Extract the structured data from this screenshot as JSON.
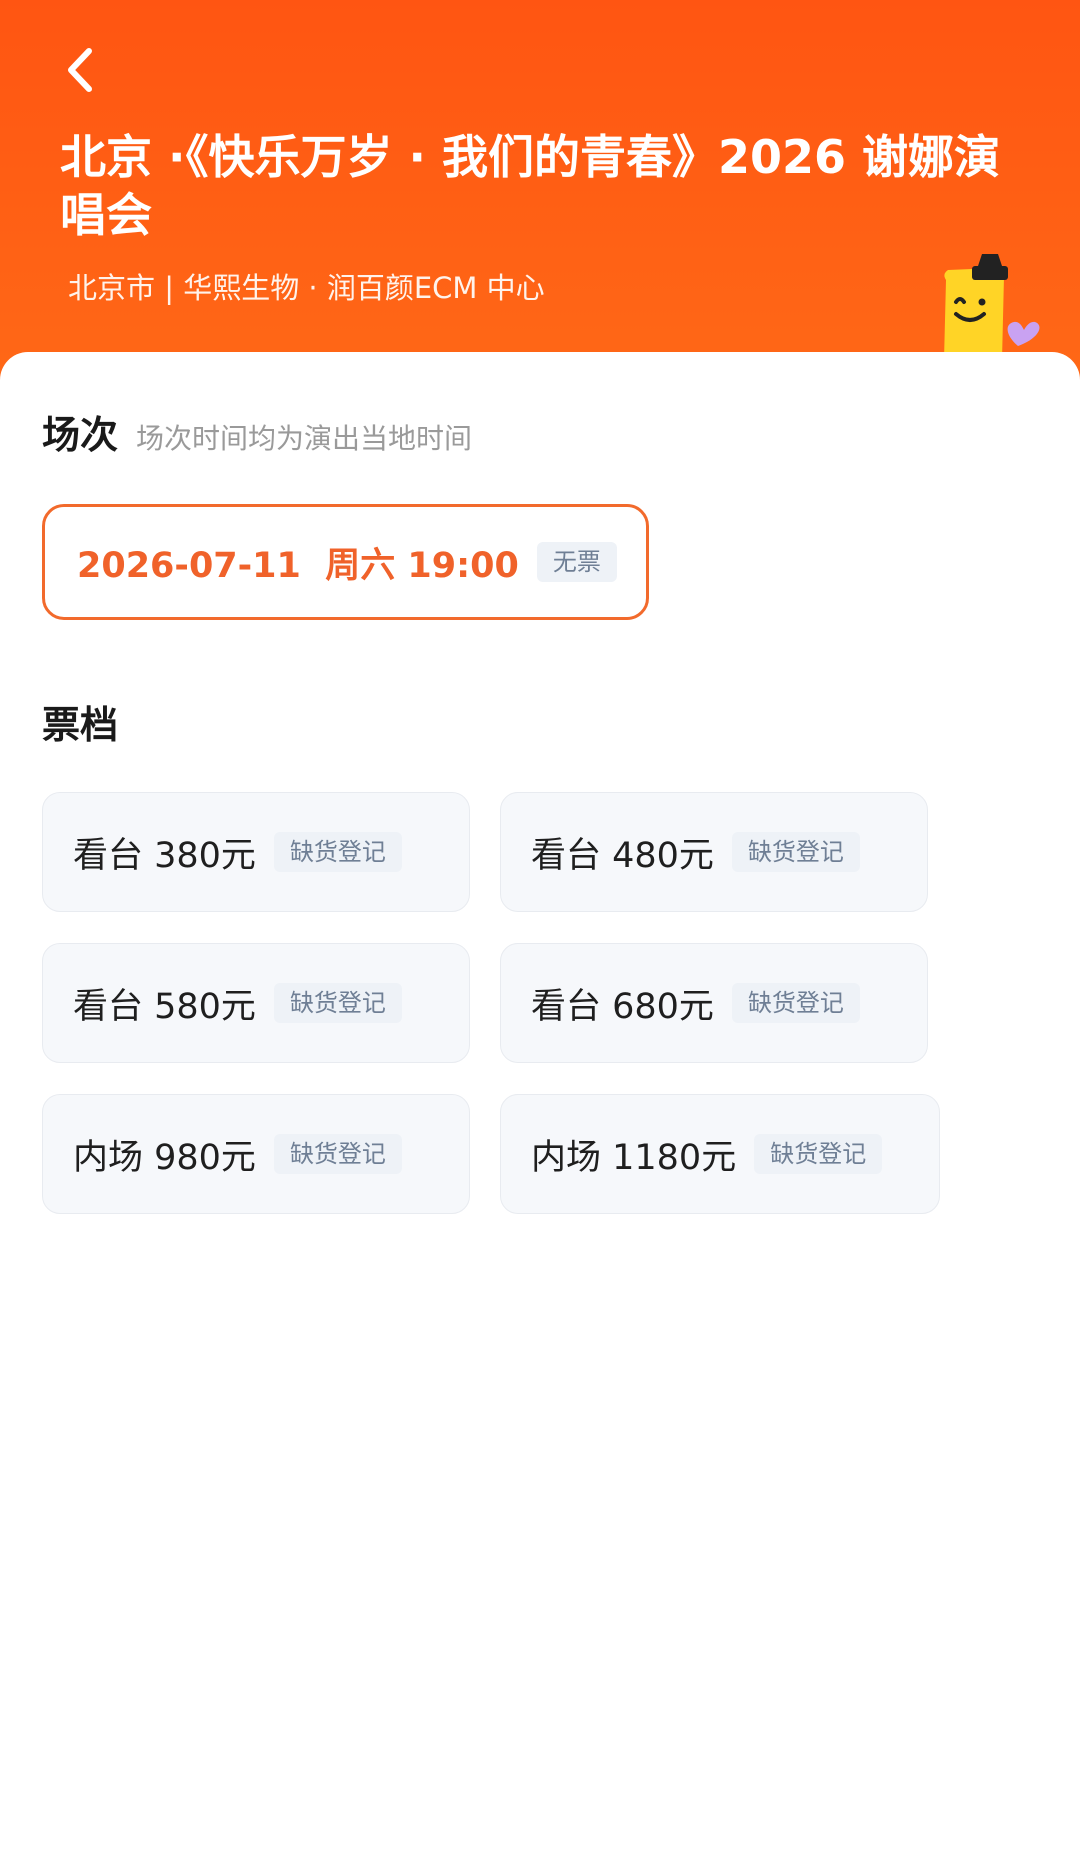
{
  "header": {
    "title": "北京 ·《快乐万岁 · 我们的青春》2026 谢娜演唱会",
    "subtitle": "北京市 | 华熙生物 · 润百颜ECM 中心",
    "back_icon": "chevron-left-icon",
    "background_color": "#ff5a14"
  },
  "session": {
    "title": "场次",
    "note": "场次时间均为演出当地时间",
    "options": [
      {
        "date": "2026-07-11  周六 19:00",
        "status": "无票"
      }
    ],
    "accent_color": "#f0622a"
  },
  "tiers": {
    "title": "票档",
    "items": [
      {
        "name": "看台 380元",
        "status": "缺货登记"
      },
      {
        "name": "看台 480元",
        "status": "缺货登记"
      },
      {
        "name": "看台 580元",
        "status": "缺货登记"
      },
      {
        "name": "看台 680元",
        "status": "缺货登记"
      },
      {
        "name": "内场 980元",
        "status": "缺货登记"
      },
      {
        "name": "内场 1180元",
        "status": "缺货登记"
      }
    ]
  }
}
